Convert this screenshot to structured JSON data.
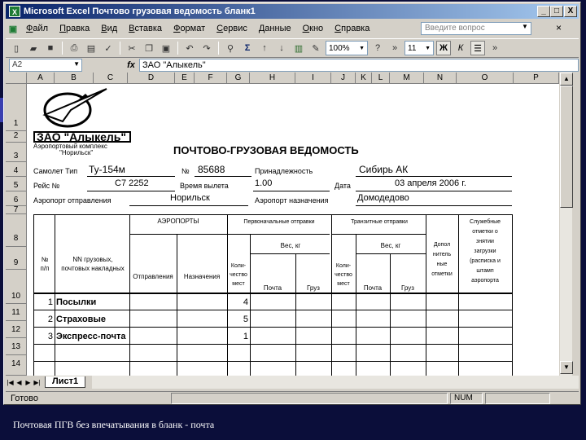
{
  "window": {
    "title": "Microsoft Excel   Почтово грузовая ведомость бланк1",
    "buttons": {
      "minimize": "_",
      "maximize": "□",
      "close": "X"
    },
    "doc_close": "×"
  },
  "menu": {
    "items": [
      "Файл",
      "Правка",
      "Вид",
      "Вставка",
      "Формат",
      "Сервис",
      "Данные",
      "Окно",
      "Справка"
    ],
    "help_placeholder": "Введите вопрос"
  },
  "toolbar": {
    "zoom": "100%",
    "font_size": "11",
    "bold": "Ж",
    "italic": "К"
  },
  "formula_bar": {
    "name_box": "A2",
    "fx": "fx",
    "formula": "ЗАО \"Алыкель\""
  },
  "columns": [
    "A",
    "B",
    "C",
    "D",
    "E",
    "F",
    "G",
    "H",
    "I",
    "J",
    "K",
    "L",
    "M",
    "N",
    "O",
    "P"
  ],
  "rows": [
    "1",
    "2",
    "3",
    "4",
    "5",
    "6",
    "7",
    "8",
    "9",
    "10",
    "11",
    "12",
    "13",
    "14"
  ],
  "sheet": {
    "company": "ЗАО \"Алыкель\"",
    "subtitle_1": "Аэропортовый комплекс",
    "subtitle_2": "\"Норильск\"",
    "title": "ПОЧТОВО-ГРУЗОВАЯ ВЕДОМОСТЬ",
    "aircraft_type_label": "Самолет Тип",
    "aircraft_type_value": "Ту-154м",
    "number_label": "№",
    "number_value": "85688",
    "owner_label": "Принадлежность",
    "owner_value": "Сибирь АК",
    "flight_label": "Рейс №",
    "flight_value": "С7 2252",
    "departure_time_label": "Время вылета",
    "departure_time_value": "1.00",
    "date_label": "Дата",
    "date_value": "03 апреля 2006 г.",
    "dep_airport_label": "Аэропорт отправления",
    "dep_airport_value": "Норильск",
    "dest_airport_label": "Аэропорт назначения",
    "dest_airport_value": "Домодедово",
    "hdr_no": "№\nп/п",
    "hdr_docs": "NN грузовых,\nпочтовых накладных",
    "hdr_airports": "АЭРОПОРТЫ",
    "hdr_departure": "Отправления",
    "hdr_destination": "Назначения",
    "hdr_initial": "Первоначальные отправки",
    "hdr_count_1": "Коли-\nчество\nмест",
    "hdr_weight_1": "Вес, кг",
    "hdr_mail_1": "Почта",
    "hdr_cargo_1": "Груз",
    "hdr_transit": "Транзитные          отправки",
    "hdr_count_2": "Коли-\nчество\nмест",
    "hdr_weight_2": "Вес, кг",
    "hdr_mail_2": "Почта",
    "hdr_cargo_2": "Груз",
    "hdr_extra": "Допол\nнитель\nные\nотметки",
    "hdr_service": "Служебные\nотметки о\nзнятии\nзагрузки\n(расписка и\nштамп\nаэропорта",
    "data_rows": [
      {
        "no": "1",
        "name": "Посылки",
        "count": "4"
      },
      {
        "no": "2",
        "name": "Страховые",
        "count": "5"
      },
      {
        "no": "3",
        "name": "Экспресс-почта",
        "count": "1"
      }
    ]
  },
  "tabs": {
    "sheet1": "Лист1"
  },
  "status": {
    "ready": "Готово",
    "num": "NUM"
  },
  "caption": "Почтовая ПГВ без впечатывания в бланк - почта"
}
